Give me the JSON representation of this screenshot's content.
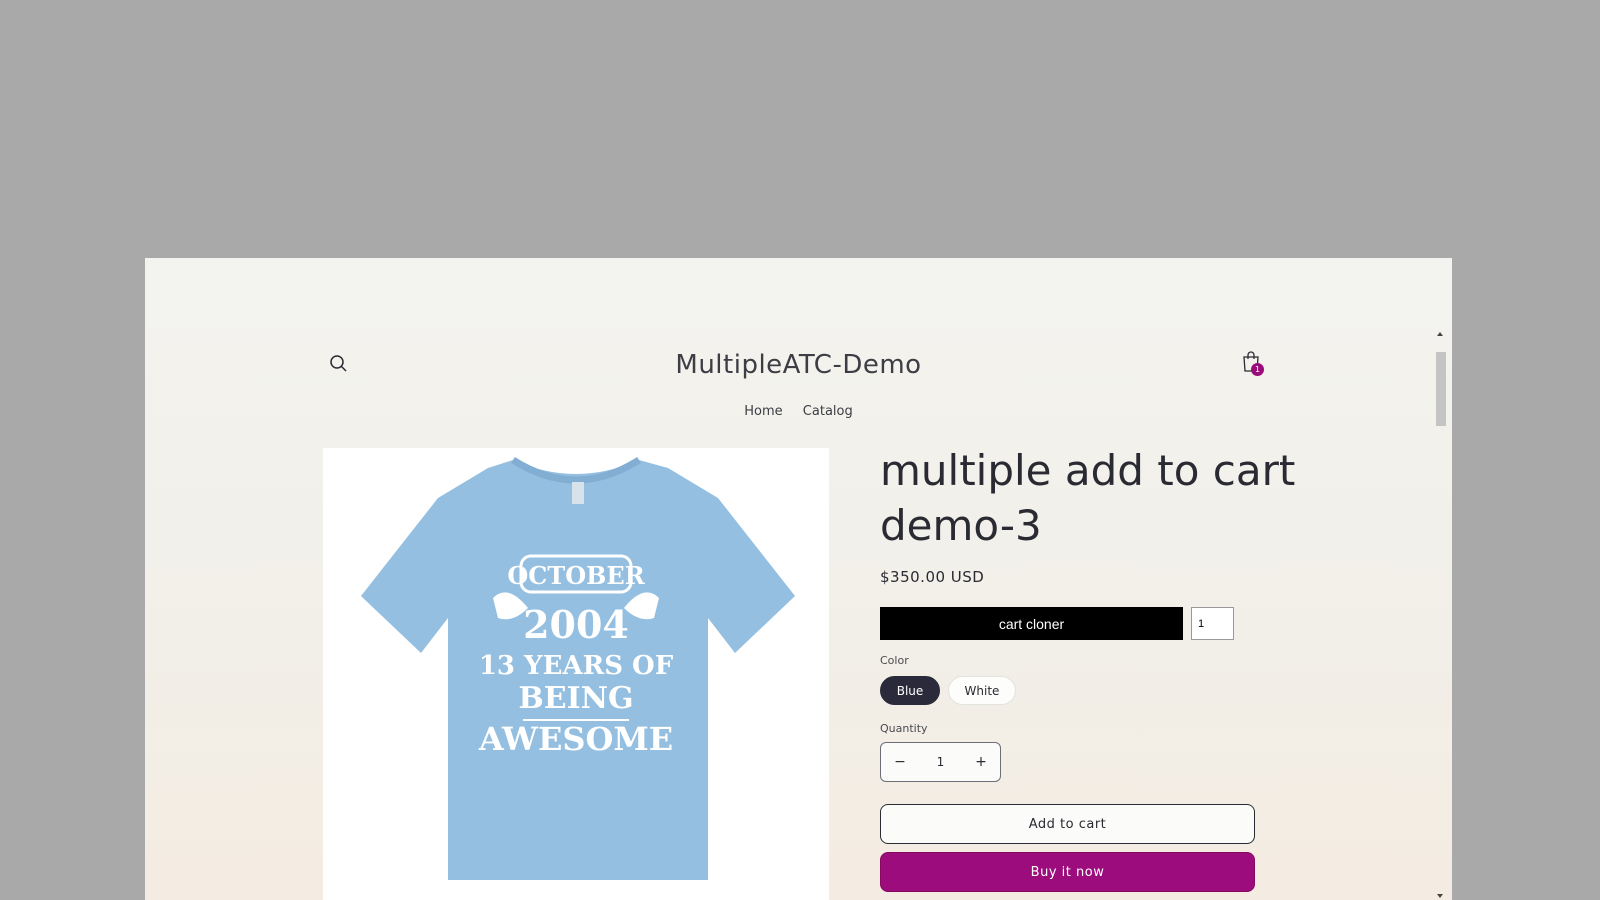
{
  "header": {
    "store_name": "MultipleATC-Demo",
    "cart_count": "1"
  },
  "nav": {
    "items": [
      "Home",
      "Catalog"
    ]
  },
  "product": {
    "title": "multiple add to cart demo-3",
    "price": "$350.00 USD",
    "image": {
      "line1": "OCTOBER",
      "line2": "2004",
      "line3": "13 YEARS OF",
      "line4": "BEING",
      "line5": "AWESOME"
    }
  },
  "cloner": {
    "label": "cart cloner",
    "qty_value": "1"
  },
  "color": {
    "label": "Color",
    "options": [
      "Blue",
      "White"
    ],
    "selected": "Blue"
  },
  "quantity": {
    "label": "Quantity",
    "value": "1",
    "minus": "−",
    "plus": "+"
  },
  "buttons": {
    "add_to_cart": "Add to cart",
    "buy_now": "Buy it now"
  },
  "colors": {
    "accent": "#9d0c7c",
    "selected_swatch": "#2a2a3a",
    "tshirt": "#94bfe0"
  }
}
